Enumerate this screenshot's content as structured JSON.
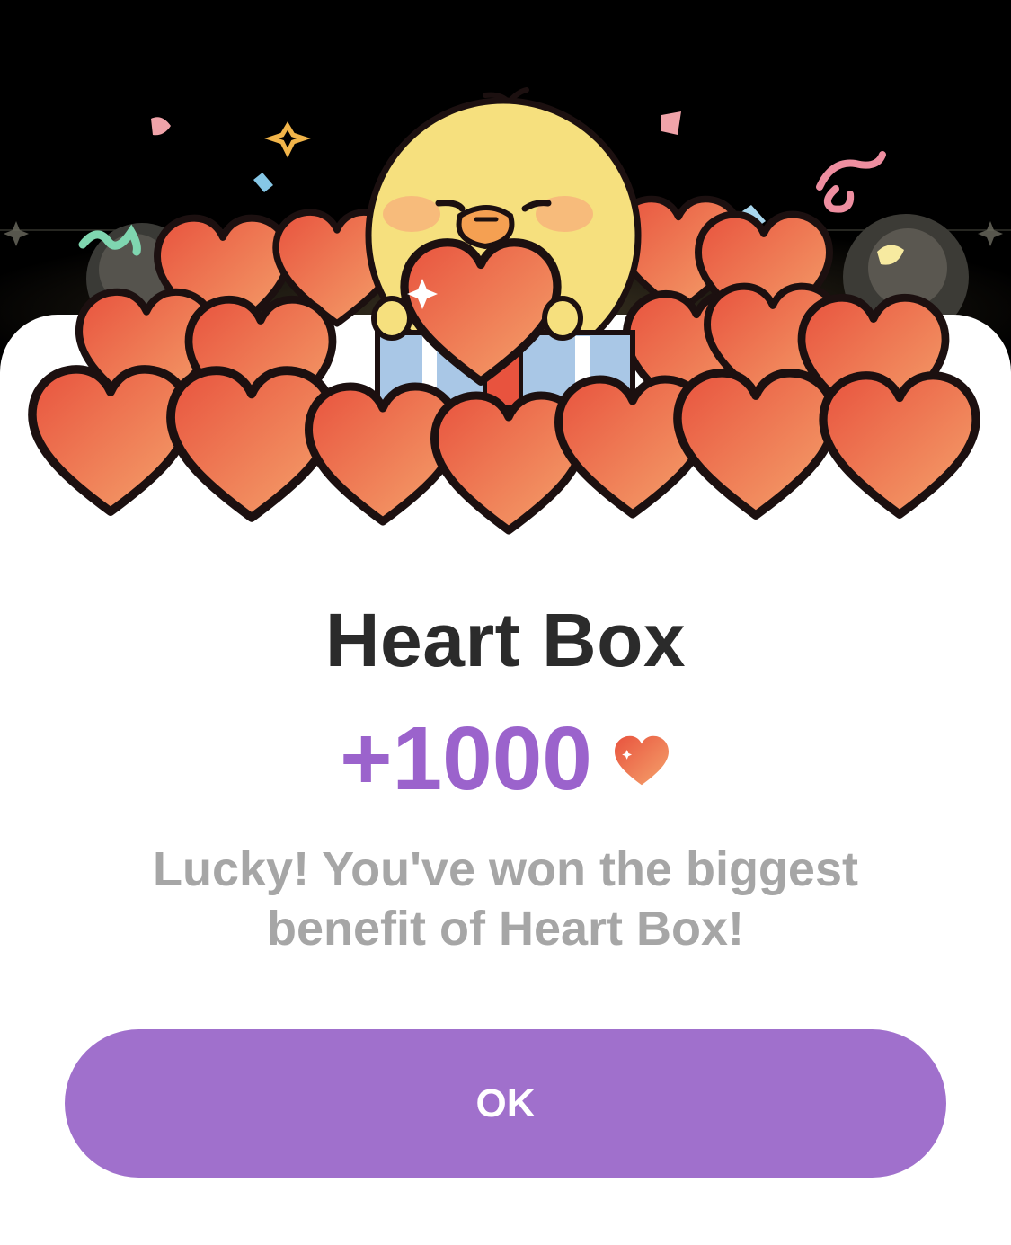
{
  "dialog": {
    "title": "Heart Box",
    "reward_amount": "+1000",
    "reward_icon": "heart-icon",
    "message": "Lucky! You've won the biggest benefit of Heart Box!",
    "ok_label": "OK"
  },
  "illustration": {
    "subject": "yellow-chick-holding-heart-icon",
    "background": "pile-of-hearts"
  },
  "colors": {
    "accent": "#9b63cc",
    "button": "#a070cc",
    "title": "#2b2b2b",
    "message": "#a6a6a6",
    "heart_start": "#e8533e",
    "heart_end": "#f5a36c"
  }
}
